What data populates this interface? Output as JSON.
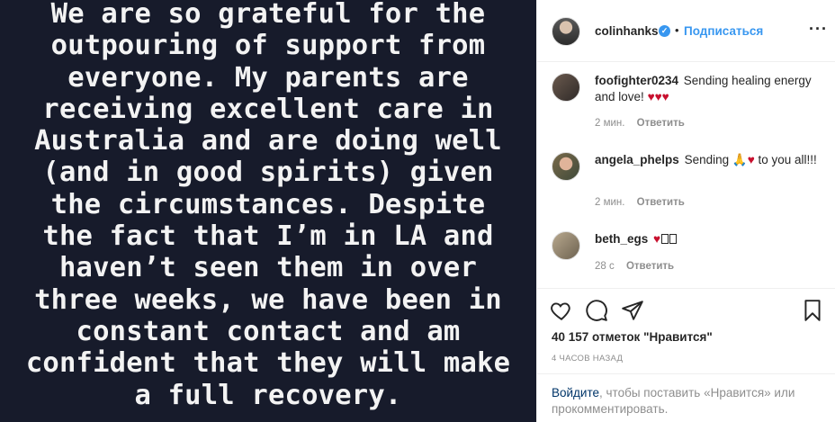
{
  "post": {
    "image_text": "We are so grateful for the\noutpouring of support from\neveryone. My parents are\nreceiving excellent care in\nAustralia and are doing well\n(and in good spirits) given\nthe circumstances. Despite\nthe fact that I’m in LA and\nhaven’t seen them in over\nthree weeks, we have been in\nconstant contact and am\nconfident that they will make\na full recovery."
  },
  "header": {
    "username": "colinhanks",
    "verified_mark": "✓",
    "separator": "•",
    "follow_label": "Подписаться",
    "more_label": "···"
  },
  "comments": [
    {
      "username": "foofighter0234",
      "text": "Sending healing energy and love!",
      "hearts": "♥♥♥",
      "time": "2 мин.",
      "reply": "Ответить"
    },
    {
      "username": "angela_phelps",
      "text_before": "Sending",
      "emoji": "🙏",
      "hearts": "♥",
      "text_after": "to you all!!!",
      "time": "2 мин.",
      "reply": "Ответить"
    },
    {
      "username": "beth_egs",
      "hearts": "♥",
      "time": "28 с",
      "reply": "Ответить"
    }
  ],
  "actions": {
    "likes": "40 157 отметок \"Нравится\"",
    "timestamp": "4 ЧАСОВ НАЗАД"
  },
  "login": {
    "link": "Войдите",
    "rest": ", чтобы поставить «Нравится» или прокомментировать."
  },
  "colors": {
    "image_bg": "#171b2b",
    "accent": "#3897f0",
    "heart": "#c8102e"
  },
  "icons": [
    "heart-icon",
    "comment-icon",
    "share-icon",
    "bookmark-icon",
    "verified-icon",
    "more-icon"
  ]
}
